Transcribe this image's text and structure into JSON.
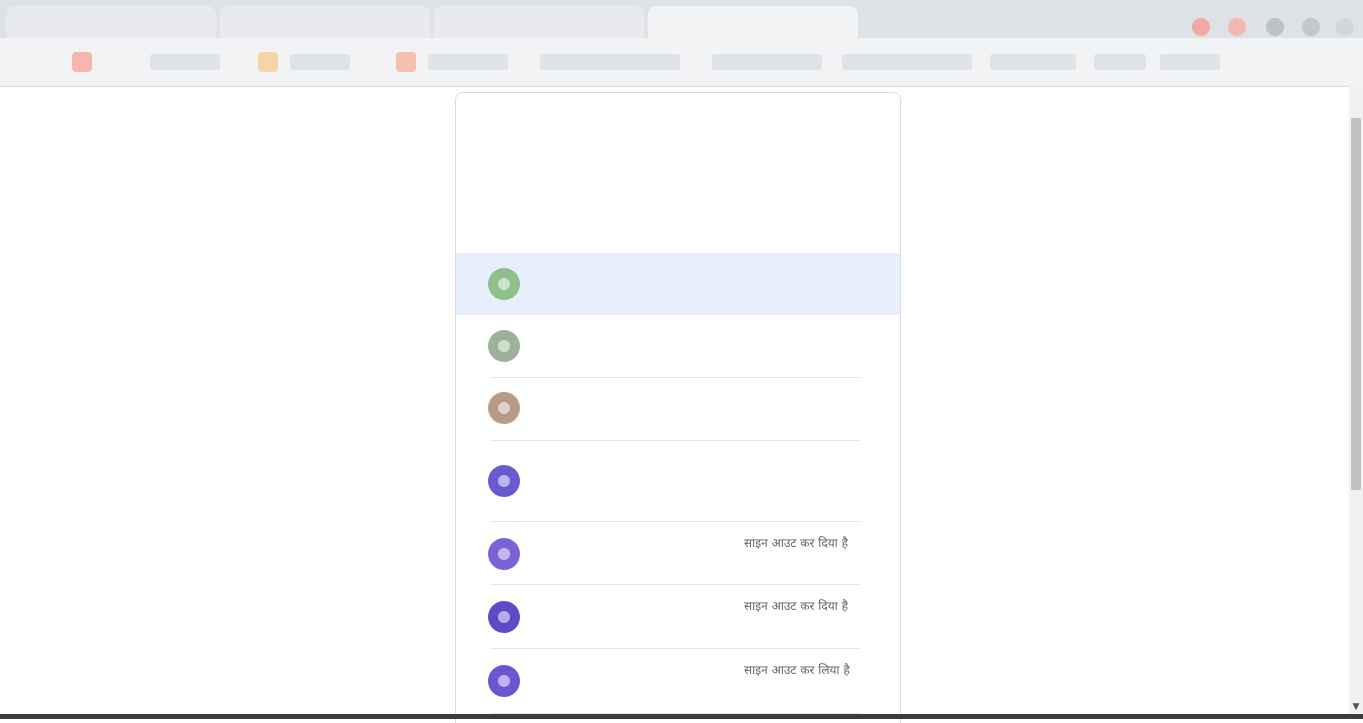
{
  "card": {
    "title": "",
    "subtitle_link": "",
    "subtitle_rest": ""
  },
  "accounts": [
    {
      "name": "",
      "email": "",
      "status": "",
      "avatar_color": "#8fbf8a",
      "highlighted": true
    },
    {
      "name": "",
      "email": "",
      "status": "",
      "avatar_color": "#9cb39a",
      "highlighted": false
    },
    {
      "name": "",
      "email": "",
      "status": "",
      "avatar_color": "#b89b86",
      "highlighted": false
    },
    {
      "name": "",
      "email": "",
      "status": "",
      "avatar_color": "#6a5ad1",
      "highlighted": false
    },
    {
      "name": "",
      "email": "",
      "status": "साइन आउट कर दिया है",
      "avatar_color": "#7b63d6",
      "highlighted": false
    },
    {
      "name": "",
      "email": "",
      "status": "साइन आउट कर दिया है",
      "avatar_color": "#5e49c8",
      "highlighted": false
    },
    {
      "name": "",
      "email": "",
      "status": "साइन आउट कर लिया है",
      "avatar_color": "#6e55d0",
      "highlighted": false
    }
  ],
  "colors": {
    "accent": "#1a73e8",
    "highlight": "#e8f0fe"
  },
  "icons": {
    "scroll_down": "▼"
  }
}
